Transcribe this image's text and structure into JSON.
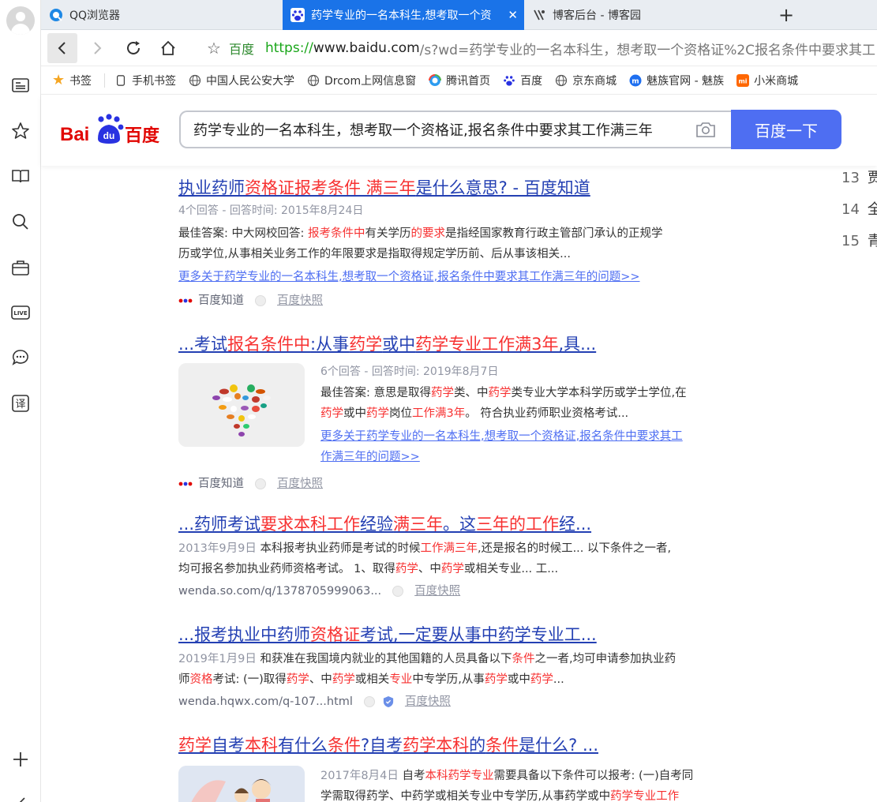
{
  "browser": {
    "tabs": [
      {
        "label": "QQ浏览器"
      },
      {
        "label": "药学专业的一名本科生,想考取一个资"
      },
      {
        "label": "博客后台 - 博客园"
      }
    ],
    "address": {
      "site_label": "百度",
      "scheme": "https://",
      "host": "www.baidu.com",
      "path": "/s?wd=药学专业的一名本科生，想考取一个资格证%2C报名条件中要求其工"
    },
    "bookmarks": [
      {
        "label": "书签"
      },
      {
        "label": "手机书签"
      },
      {
        "label": "中国人民公安大学"
      },
      {
        "label": "Drcom上网信息窗"
      },
      {
        "label": "腾讯首页"
      },
      {
        "label": "百度"
      },
      {
        "label": "京东商城"
      },
      {
        "label": "魅族官网 - 魅族"
      },
      {
        "label": "小米商城"
      }
    ]
  },
  "baidu": {
    "logo_text": "百度",
    "query": "药学专业的一名本科生，想考取一个资格证,报名条件中要求其工作满三年",
    "search_button": "百度一下"
  },
  "right_rail": [
    {
      "n": "13",
      "t": "贾"
    },
    {
      "n": "14",
      "t": "全"
    },
    {
      "n": "15",
      "t": "青"
    }
  ],
  "results": [
    {
      "title_parts": [
        [
          "执业药师",
          false
        ],
        [
          "资格证报考条件 满三年",
          true
        ],
        [
          "是什么意思? - 百度知道",
          false
        ]
      ],
      "meta": "4个回答 - 回答时间: 2015年8月24日",
      "abs_line1_parts": [
        [
          "最佳答案: 中大网校回答: ",
          false
        ],
        [
          "报考条件中",
          true
        ],
        [
          "有关学历",
          false
        ],
        [
          "的要求",
          true
        ],
        [
          "是指经国家教育行政主管部门承认的正规学",
          false
        ]
      ],
      "abs_line2": "历或学位,从事相关业务工作的年限要求是指取得规定学历前、后从事该相关...",
      "more": "更多关于药学专业的一名本科生,想考取一个资格证,报名条件中要求其工作满三年的问题>>",
      "source": "百度知道",
      "snapshot": "百度快照"
    },
    {
      "title_parts": [
        [
          "...考试",
          false
        ],
        [
          "报名条件中",
          true
        ],
        [
          ":从事",
          false
        ],
        [
          "药学",
          true
        ],
        [
          "或中",
          false
        ],
        [
          "药学专业工作满3年",
          true
        ],
        [
          ",具...",
          false
        ]
      ],
      "meta": "6个回答 - 回答时间: 2019年8月7日",
      "abs_line1_parts": [
        [
          "最佳答案: 意思是取得",
          false
        ],
        [
          "药学",
          true
        ],
        [
          "类、中",
          false
        ],
        [
          "药学",
          true
        ],
        [
          "类专业大学本科学历或学士学位,在",
          false
        ]
      ],
      "abs_line2_parts": [
        [
          "药学",
          true
        ],
        [
          "或中",
          false
        ],
        [
          "药学",
          true
        ],
        [
          "岗位",
          false
        ],
        [
          "工作满3年",
          true
        ],
        [
          "。 符合执业药师职业资格考试...",
          false
        ]
      ],
      "more_line1": "更多关于药学专业的一名本科生,想考取一个资格证,报名条件中要求其工",
      "more_line2": "作满三年的问题>>",
      "source": "百度知道",
      "snapshot": "百度快照",
      "thumb": "heart-shaped-pills-image"
    },
    {
      "title_parts": [
        [
          "...药师考试",
          false
        ],
        [
          "要求本科工作",
          true
        ],
        [
          "经验",
          false
        ],
        [
          "满三年",
          true
        ],
        [
          "。这",
          false
        ],
        [
          "三年的工作",
          true
        ],
        [
          "经...",
          false
        ]
      ],
      "abs_line1_parts": [
        [
          "2013年9月9日",
          "date"
        ],
        [
          " 本科报考执业药师是考试的时候",
          false
        ],
        [
          "工作满三年",
          true
        ],
        [
          ",还是报名的时候工... 以下条件之一者,",
          false
        ]
      ],
      "abs_line2_parts": [
        [
          "均可报名参加执业药师资格考试。 1、取得",
          false
        ],
        [
          "药学",
          true
        ],
        [
          "、中",
          false
        ],
        [
          "药学",
          true
        ],
        [
          "或相关专业... 工...",
          false
        ]
      ],
      "url": "wenda.so.com/q/1378705999063...",
      "snapshot": "百度快照"
    },
    {
      "title_parts": [
        [
          "...报考执业中药师",
          false
        ],
        [
          "资格证",
          true
        ],
        [
          "考试,一定要从事中药学专业工...",
          false
        ]
      ],
      "abs_line1_parts": [
        [
          "2019年1月9日",
          "date"
        ],
        [
          " 和获准在我国境内就业的其他国籍的人员具备以下",
          false
        ],
        [
          "条件",
          true
        ],
        [
          "之一者,均可申请参加执业药",
          false
        ]
      ],
      "abs_line2_parts": [
        [
          "师",
          false
        ],
        [
          "资格",
          true
        ],
        [
          "考试: (一)取得",
          false
        ],
        [
          "药学",
          true
        ],
        [
          "、中",
          false
        ],
        [
          "药学",
          true
        ],
        [
          "或相关",
          false
        ],
        [
          "专业",
          true
        ],
        [
          "中专学历,从事",
          false
        ],
        [
          "药学",
          true
        ],
        [
          "或中",
          false
        ],
        [
          "药学",
          true
        ],
        [
          "...",
          false
        ]
      ],
      "url": "wenda.hqwx.com/q-107...html",
      "snapshot": "百度快照"
    },
    {
      "title_parts": [
        [
          "药学",
          true
        ],
        [
          "自考",
          false
        ],
        [
          "本科",
          true
        ],
        [
          "有什么",
          false
        ],
        [
          "条件",
          true
        ],
        [
          "?自考",
          false
        ],
        [
          "药学本科",
          true
        ],
        [
          "的",
          false
        ],
        [
          "条件",
          true
        ],
        [
          "是什么? ...",
          false
        ]
      ],
      "abs_line1_parts": [
        [
          "2017年8月4日",
          "date"
        ],
        [
          " 自考",
          false
        ],
        [
          "本科药学专业",
          true
        ],
        [
          "需要具备以下条件可以报考: (一)自考同",
          false
        ]
      ],
      "abs_line2_parts": [
        [
          "学需取得药学、中药学或相关专业中专学历,从事药学或中",
          false
        ],
        [
          "药学专业工作",
          true
        ]
      ],
      "thumb": "cartoon-image"
    }
  ]
}
